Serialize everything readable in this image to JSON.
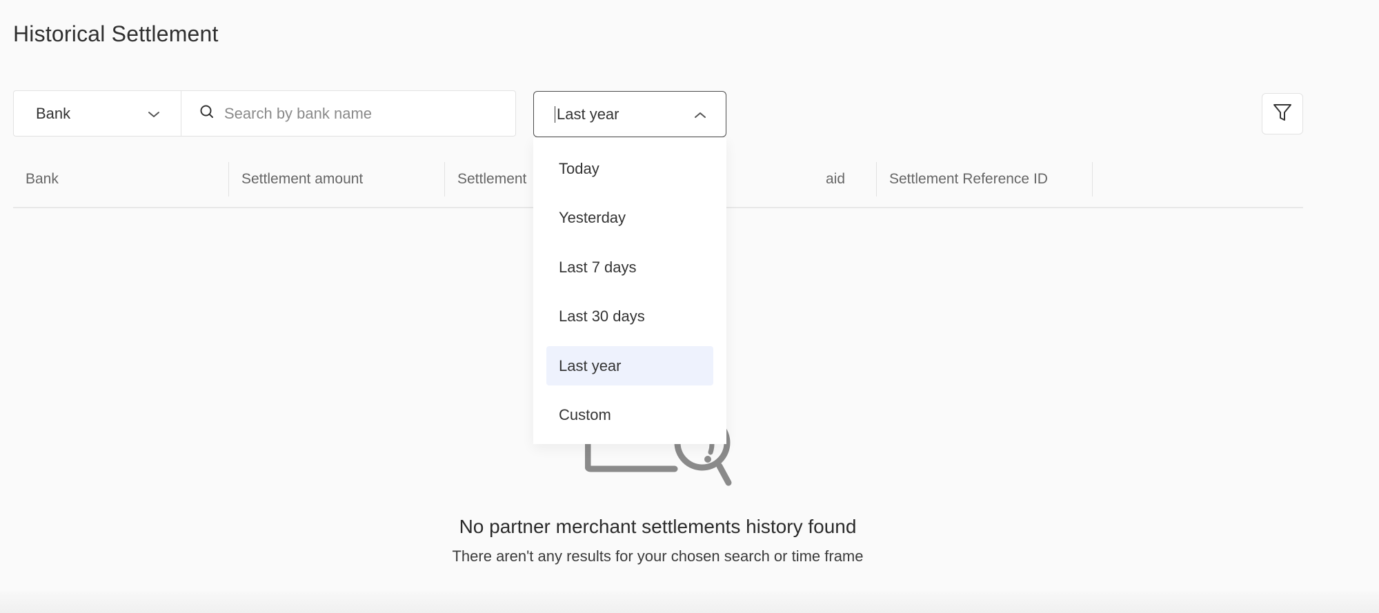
{
  "page": {
    "title": "Historical Settlement"
  },
  "filters": {
    "bank_select_value": "Bank",
    "search_placeholder": "Search by bank name",
    "date_range_value": "Last year",
    "date_range_options": [
      "Today",
      "Yesterday",
      "Last 7 days",
      "Last 30 days",
      "Last year",
      "Custom"
    ],
    "date_range_selected_index": 4
  },
  "table": {
    "columns": [
      "Bank",
      "Settlement amount",
      "Settlement",
      "aid",
      "Settlement Reference ID"
    ]
  },
  "empty_state": {
    "title": "No partner merchant settlements history found",
    "subtitle": "There aren't any results for your chosen search or time frame"
  },
  "icons": {
    "bank_chevron": "chevron-down-icon",
    "search": "search-icon",
    "date_chevron": "chevron-up-icon",
    "filter": "funnel-filter-icon",
    "illustration": "magnifying-glass-empty-icon"
  },
  "colors": {
    "background": "#fafafa",
    "selected_option_bg": "#eef2fd",
    "border": "#e2e2e2",
    "active_border": "#4a4a4a"
  }
}
